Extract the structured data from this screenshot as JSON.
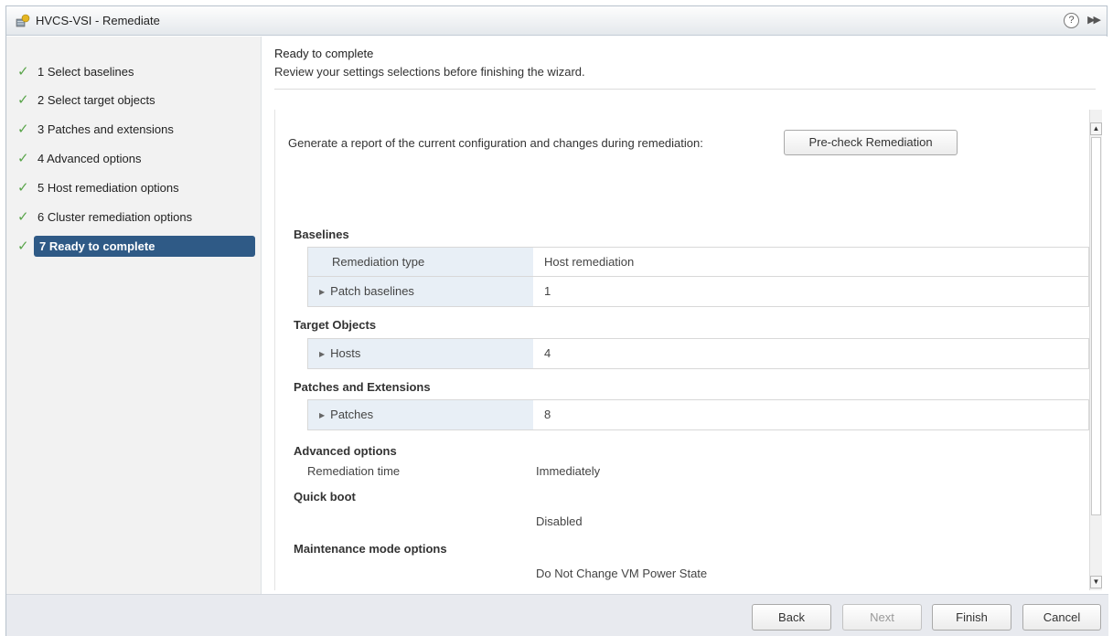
{
  "window": {
    "title": "HVCS-VSI - Remediate"
  },
  "sidebar": {
    "steps": [
      {
        "label": "1  Select baselines"
      },
      {
        "label": "2  Select target objects"
      },
      {
        "label": "3  Patches and extensions"
      },
      {
        "label": "4  Advanced options"
      },
      {
        "label": "5  Host remediation options"
      },
      {
        "label": "6  Cluster remediation options"
      },
      {
        "label": "7  Ready to complete"
      }
    ]
  },
  "main": {
    "title": "Ready to complete",
    "subtitle": "Review your settings selections before finishing the wizard.",
    "generate_text": "Generate a report of the current configuration and changes during remediation:",
    "precheck_label": "Pre-check Remediation",
    "baselines": {
      "heading": "Baselines",
      "rows": [
        {
          "key": "Remediation type",
          "value": "Host remediation"
        },
        {
          "key": "Patch baselines",
          "value": "1"
        }
      ]
    },
    "target_objects": {
      "heading": "Target Objects",
      "rows": [
        {
          "key": "Hosts",
          "value": "4"
        }
      ]
    },
    "patches": {
      "heading": "Patches and Extensions",
      "rows": [
        {
          "key": "Patches",
          "value": "8"
        }
      ]
    },
    "advanced": {
      "heading": "Advanced options",
      "key": "Remediation time",
      "value": "Immediately"
    },
    "quick_boot": {
      "heading": "Quick boot",
      "value": "Disabled"
    },
    "maintenance": {
      "heading": "Maintenance mode options",
      "value": "Do Not Change VM Power State"
    }
  },
  "footer": {
    "back": "Back",
    "next": "Next",
    "finish": "Finish",
    "cancel": "Cancel"
  },
  "colors": {
    "active_step": "#2f5a86",
    "check": "#5aa54b",
    "key_cell": "#e8eff6"
  }
}
